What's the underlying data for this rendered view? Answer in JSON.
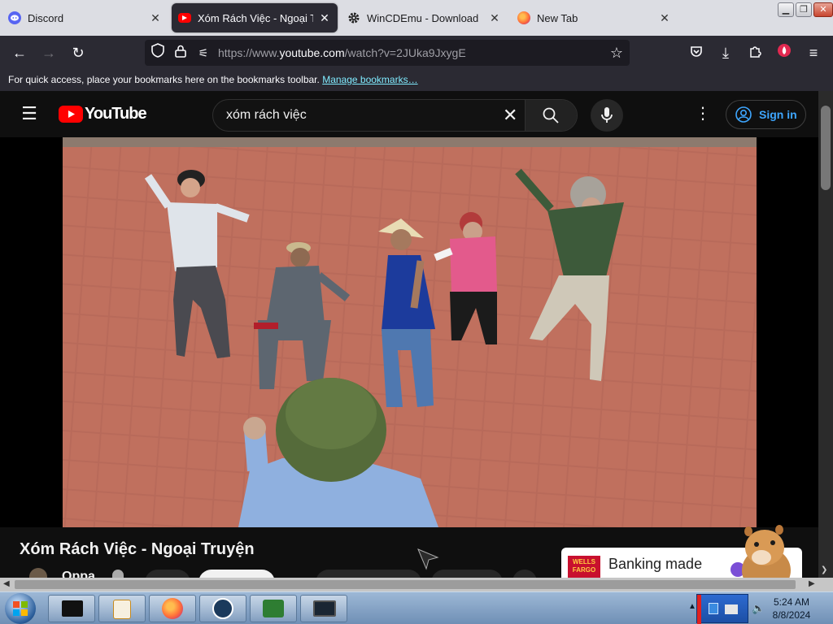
{
  "browser": {
    "tabs": [
      {
        "title": "Discord",
        "favicon": "discord-icon",
        "active": false
      },
      {
        "title": "Xóm Rách Việc - Ngoại Truyện",
        "favicon": "youtube-icon",
        "active": true
      },
      {
        "title": "WinCDEmu - Download",
        "favicon": "gear-icon",
        "active": false
      },
      {
        "title": "New Tab",
        "favicon": "firefox-icon",
        "active": false
      }
    ],
    "url_prefix": "https://www.",
    "url_domain": "youtube.com",
    "url_rest": "/watch?v=2JUka9JxygE",
    "bookmarks_message": "For quick access, place your bookmarks here on the bookmarks toolbar.",
    "bookmarks_link": "Manage bookmarks…"
  },
  "youtube": {
    "logo_text": "YouTube",
    "search_query": "xóm rách việc",
    "signin_label": "Sign in",
    "video_title": "Xóm Rách Việc - Ngoại Truyện",
    "channel_name": "Oppa",
    "ad_brand": "WELLS FARGO",
    "ad_text": "Banking made"
  },
  "taskbar": {
    "time": "5:24 AM",
    "date": "8/8/2024"
  },
  "colors": {
    "youtube_red": "#ff0000",
    "accent_blue": "#3ea6ff",
    "firefox_toolbar": "#2b2a33"
  }
}
